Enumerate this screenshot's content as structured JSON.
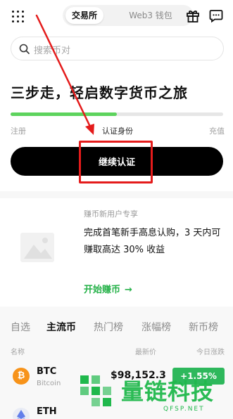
{
  "header": {
    "tabs": [
      {
        "label": "交易所",
        "active": true
      },
      {
        "label": "Web3 钱包",
        "active": false
      }
    ],
    "icons": [
      "grid-menu-icon",
      "gift-icon",
      "chat-icon"
    ]
  },
  "search": {
    "placeholder": "搜索币对"
  },
  "onboarding": {
    "headline": "三步走，轻启数字货币之旅",
    "progress_fraction": 0.5,
    "steps": [
      "注册",
      "认证身份",
      "充值"
    ],
    "button_label": "继续认证"
  },
  "promo": {
    "tag": "赚币新用户专享",
    "text": "完成首笔新手高息认购，3 天内可赚取高达 30% 收益",
    "link": "开始赚币"
  },
  "market": {
    "tabs": [
      {
        "label": "自选",
        "active": false
      },
      {
        "label": "主流币",
        "active": true
      },
      {
        "label": "热门榜",
        "active": false
      },
      {
        "label": "涨幅榜",
        "active": false
      },
      {
        "label": "新币榜",
        "active": false
      }
    ],
    "columns": {
      "name": "名称",
      "price": "最新价",
      "change": "今日涨跌"
    },
    "rows": [
      {
        "symbol": "BTC",
        "name": "Bitcoin",
        "price": "$98,152.3",
        "change": "+1.55%"
      },
      {
        "symbol": "ETH",
        "name": "",
        "price": "",
        "change": ""
      }
    ]
  },
  "watermark": {
    "text": "量链科技",
    "sub": "QFSP.NET"
  },
  "colors": {
    "accent_green": "#27b24a",
    "progress_green": "#5dd35d",
    "annotation_red": "#e41b1b",
    "button_black": "#000000"
  }
}
